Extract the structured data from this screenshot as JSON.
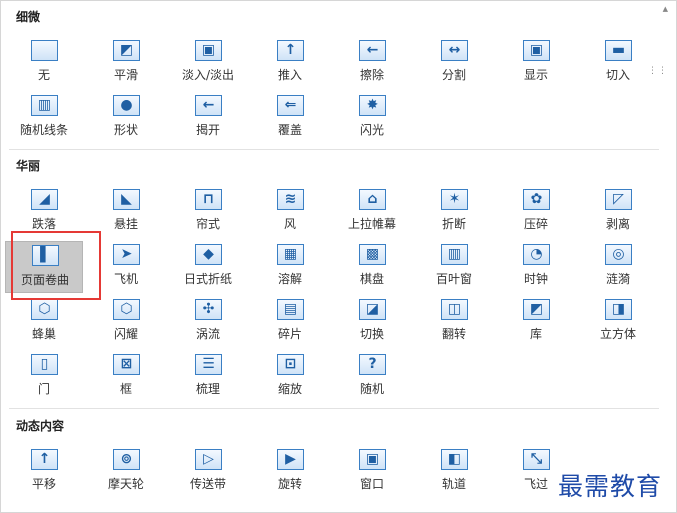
{
  "sections": [
    {
      "title": "细微",
      "items": [
        "无",
        "平滑",
        "淡入/淡出",
        "推入",
        "擦除",
        "分割",
        "显示",
        "切入",
        "随机线条",
        "形状",
        "揭开",
        "覆盖",
        "闪光"
      ]
    },
    {
      "title": "华丽",
      "items": [
        "跌落",
        "悬挂",
        "帘式",
        "风",
        "上拉帷幕",
        "折断",
        "压碎",
        "剥离",
        "页面卷曲",
        "飞机",
        "日式折纸",
        "溶解",
        "棋盘",
        "百叶窗",
        "时钟",
        "涟漪",
        "蜂巢",
        "闪耀",
        "涡流",
        "碎片",
        "切换",
        "翻转",
        "库",
        "立方体",
        "门",
        "框",
        "梳理",
        "缩放",
        "随机"
      ]
    },
    {
      "title": "动态内容",
      "items": [
        "平移",
        "摩天轮",
        "传送带",
        "旋转",
        "窗口",
        "轨道",
        "飞过"
      ]
    }
  ],
  "selected_item": "页面卷曲",
  "icons": {
    "细微": [
      "none-icon",
      "smooth-icon",
      "fade-icon",
      "push-icon",
      "wipe-icon",
      "split-icon",
      "reveal-icon",
      "cut-icon",
      "random-bars-icon",
      "shape-icon",
      "uncover-icon",
      "cover-icon",
      "flash-icon"
    ],
    "华丽": [
      "fall-over-icon",
      "drape-icon",
      "curtains-icon",
      "wind-icon",
      "prestige-icon",
      "fracture-icon",
      "crush-icon",
      "peel-off-icon",
      "page-curl-icon",
      "airplane-icon",
      "origami-icon",
      "dissolve-icon",
      "checkerboard-icon",
      "blinds-icon",
      "clock-icon",
      "ripple-icon",
      "honeycomb-icon",
      "glitter-icon",
      "vortex-icon",
      "shred-icon",
      "switch-icon",
      "flip-icon",
      "gallery-icon",
      "cube-icon",
      "doors-icon",
      "box-icon",
      "comb-icon",
      "zoom-icon",
      "random-icon"
    ],
    "动态内容": [
      "pan-icon",
      "ferris-wheel-icon",
      "conveyor-icon",
      "rotate-icon",
      "window-icon",
      "orbit-icon",
      "fly-through-icon"
    ]
  },
  "watermark": "最需教育",
  "colors": {
    "accent": "#2e7cc8",
    "highlight": "#e53935",
    "selected_bg": "#c9c9c9",
    "watermark": "#1f4ba8"
  }
}
